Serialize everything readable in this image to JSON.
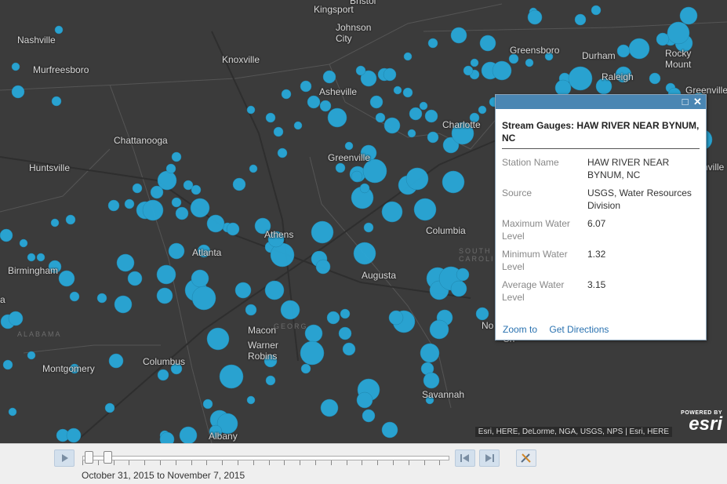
{
  "map": {
    "cities": [
      {
        "name": "Bristol"
      },
      {
        "name": "Kingsport"
      },
      {
        "name": "Johnson\nCity"
      },
      {
        "name": "Nashville"
      },
      {
        "name": "Murfreesboro"
      },
      {
        "name": "Knoxville"
      },
      {
        "name": "Greensboro"
      },
      {
        "name": "Durham"
      },
      {
        "name": "Raleigh"
      },
      {
        "name": "Rocky\nMount"
      },
      {
        "name": "Greenville"
      },
      {
        "name": "Asheville"
      },
      {
        "name": "Charlotte"
      },
      {
        "name": "Chattanooga"
      },
      {
        "name": "Huntsville"
      },
      {
        "name": "Greenville"
      },
      {
        "name": "Columbia"
      },
      {
        "name": "Athens"
      },
      {
        "name": "Atlanta"
      },
      {
        "name": "Birmingham"
      },
      {
        "name": "Augusta"
      },
      {
        "name": "Macon"
      },
      {
        "name": "Warner\nRobins"
      },
      {
        "name": "Montgomery"
      },
      {
        "name": "Columbus"
      },
      {
        "name": "Savannah"
      },
      {
        "name": "Albany"
      },
      {
        "name": "nville"
      },
      {
        "name": "a"
      },
      {
        "name": "No"
      },
      {
        "name": "Ch"
      }
    ],
    "regions": [
      "ALABAMA",
      "SOUTH\nCAROLINA",
      "GEORG"
    ],
    "attribution": "Esri, HERE, DeLorme, NGA, USGS, NPS | Esri, HERE",
    "esri_powered": "POWERED BY",
    "esri_logo": "esri",
    "marker_color": "#29a8d8",
    "background_color": "#3b3b3b"
  },
  "popup": {
    "title": "Stream Gauges: HAW RIVER NEAR BYNUM, NC",
    "fields": [
      {
        "label": "Station Name",
        "value": "HAW RIVER NEAR BYNUM, NC"
      },
      {
        "label": "Source",
        "value": "USGS, Water Resources Division"
      },
      {
        "label": "Maximum Water Level",
        "value": "6.07"
      },
      {
        "label": "Minimum Water Level",
        "value": "1.32"
      },
      {
        "label": "Average Water Level",
        "value": "3.15"
      }
    ],
    "zoom_to": "Zoom to",
    "get_directions": "Get Directions",
    "maximize_icon": "maximize-icon",
    "close_icon": "close-icon"
  },
  "timeslider": {
    "time_range": "October 31, 2015 to November 7, 2015",
    "play_icon": "play-icon",
    "previous_icon": "previous-icon",
    "next_icon": "next-icon",
    "tools_icon": "tools-icon"
  }
}
